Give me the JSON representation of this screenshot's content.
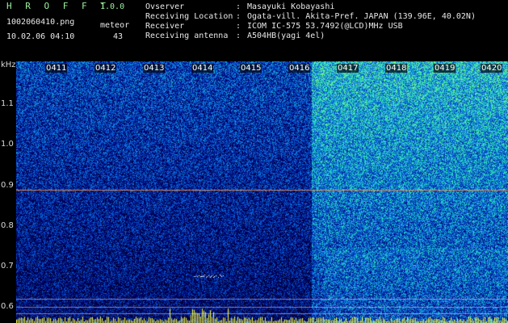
{
  "header": {
    "app_title": "H R O F F T",
    "app_version": "1.0.0",
    "file_name": "1002060410.png",
    "datetime": "10.02.06 04:10",
    "meteor_label": "meteor",
    "meteor_count": "43",
    "info": [
      {
        "label": "Ovserver",
        "value": "Masayuki Kobayashi"
      },
      {
        "label": "Receiving Location",
        "value": "Ogata-vill. Akita-Pref. JAPAN (139.96E, 40.02N)"
      },
      {
        "label": "Receiver",
        "value": "ICOM IC-575 53.7492(@LCD)MHz USB"
      },
      {
        "label": "Receiving antenna",
        "value": "A504HB(yagi 4el)"
      }
    ],
    "colon": ":"
  },
  "plot": {
    "y_unit": "kHz",
    "y_ticks": [
      "1.1",
      "1.0",
      "0.9",
      "0.8",
      "0.7",
      "0.6"
    ],
    "time_ticks": [
      "0411",
      "0412",
      "0413",
      "0414",
      "0415",
      "0416",
      "0417",
      "0418",
      "0419",
      "0420"
    ],
    "colors": {
      "background_noise": "#0a1080",
      "strong_noise": "#40e8b0",
      "carrier_line": "#ff9a4a",
      "guide_lines": "#c8c8ff",
      "level_bars": "#ffff40"
    }
  }
}
